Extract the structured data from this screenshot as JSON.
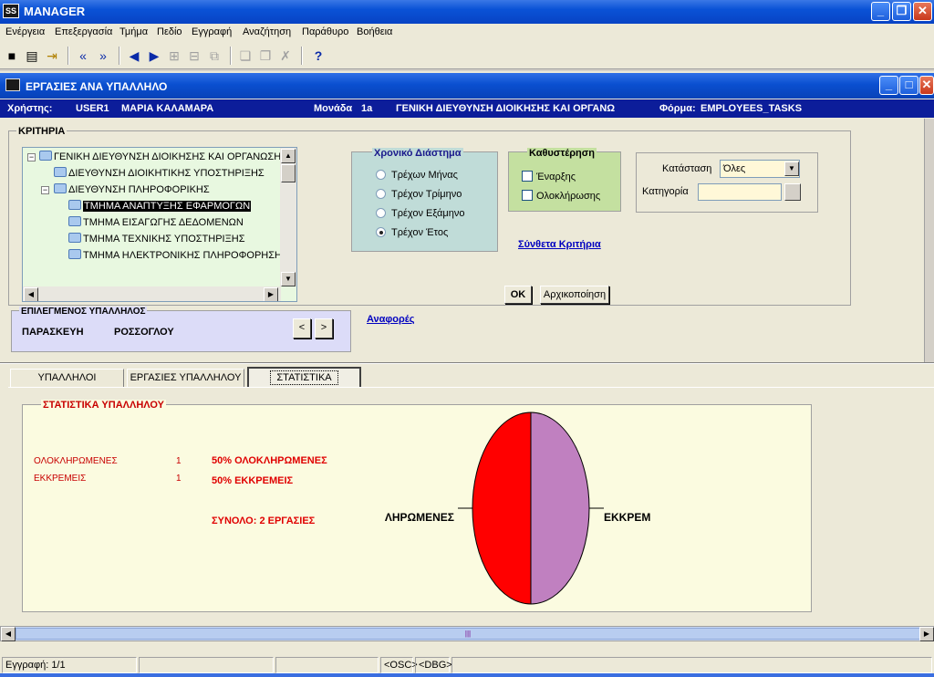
{
  "app": {
    "title": "MANAGER",
    "icon": "app-logo-icon"
  },
  "window_buttons": [
    "minimize-icon",
    "restore-icon",
    "close-icon"
  ],
  "menu": [
    "Ενέργεια",
    "Επεξεργασία",
    "Τμήμα",
    "Πεδίο",
    "Εγγραφή",
    "Αναζήτηση",
    "Παράθυρο",
    "Βοήθεια"
  ],
  "toolbar": {
    "icons": [
      "save-icon",
      "print-icon",
      "exit-icon",
      "first-record-icon",
      "last-record-icon",
      "previous-icon",
      "next-icon",
      "insert-record-icon",
      "delete-record-icon",
      "duplicate-icon",
      "copy-icon",
      "paste-icon",
      "clear-icon",
      "help-icon"
    ],
    "help_glyph": "?"
  },
  "form": {
    "title": "ΕΡΓΑΣΙΕΣ ΑΝΑ ΥΠΑΛΛΗΛΟ",
    "user_label": "Χρήστης:",
    "user_code": "USER1",
    "user_name": "ΜΑΡΙΑ ΚΑΛΑΜΑΡΑ",
    "unit_label": "Μονάδα",
    "unit_code": "1a",
    "unit_name": "ΓΕΝΙΚΗ ΔΙΕΥΘΥΝΣΗ ΔΙΟΙΚΗΣΗΣ ΚΑΙ ΟΡΓΑΝΩ",
    "form_label": "Φόρμα:",
    "form_code": "EMPLOYEES_TASKS"
  },
  "criteria": {
    "title": "ΚΡΙΤΗΡΙΑ",
    "tree": [
      {
        "label": "ΓΕΝΙΚΗ ΔΙΕΥΘΥΝΣΗ ΔΙΟΙΚΗΣΗΣ ΚΑΙ ΟΡΓΑΝΩΣΗΣ",
        "selected": false
      },
      {
        "label": "ΔΙΕΥΘΥΝΣΗ ΔΙΟΙΚΗΤΙΚΗΣ ΥΠΟΣΤΗΡΙΞΗΣ",
        "selected": false
      },
      {
        "label": "ΔΙΕΥΘΥΝΣΗ ΠΛΗΡΟΦΟΡΙΚΗΣ",
        "selected": false
      },
      {
        "label": "ΤΜΗΜΑ ΑΝΑΠΤΥΞΗΣ ΕΦΑΡΜΟΓΩΝ",
        "selected": true
      },
      {
        "label": "ΤΜΗΜΑ ΕΙΣΑΓΩΓΗΣ ΔΕΔΟΜΕΝΩΝ",
        "selected": false
      },
      {
        "label": "ΤΜΗΜΑ ΤΕΧΝΙΚΗΣ ΥΠΟΣΤΗΡΙΞΗΣ",
        "selected": false
      },
      {
        "label": "ΤΜΗΜΑ ΗΛΕΚΤΡΟΝΙΚΗΣ ΠΛΗΡΟΦΟΡΗΣΗΣ",
        "selected": false
      }
    ],
    "period": {
      "title": "Χρονικό Διάστημα",
      "options": [
        "Τρέχων Μήνας",
        "Τρέχον Τρίμηνο",
        "Τρέχον Εξάμηνο",
        "Τρέχον Έτος"
      ],
      "selected": "Τρέχον Έτος"
    },
    "delay": {
      "title": "Καθυστέρηση",
      "options": [
        "Έναρξης",
        "Ολοκλήρωσης"
      ],
      "checked": []
    },
    "status_label": "Κατάσταση",
    "status_value": "Όλες",
    "category_label": "Κατηγορία",
    "category_value": "",
    "composite_link": "Σύνθετα Κριτήρια",
    "ok_button": "OK",
    "reset_button": "Αρχικοποίηση"
  },
  "selected_employee": {
    "title": "ΕΠΙΛΕΓΜΕΝΟΣ ΥΠΑΛΛΗΛΟΣ",
    "first_name": "ΠΑΡΑΣΚΕΥΗ",
    "last_name": "ΡΟΣΣΟΓΛΟΥ",
    "prev_label": "<",
    "next_label": ">"
  },
  "reports_link": "Αναφορές",
  "tabs": [
    "ΥΠΑΛΛΗΛΟΙ",
    "ΕΡΓΑΣΙΕΣ ΥΠΑΛΛΗΛΟΥ",
    "ΣΤΑΤΙΣΤΙΚΑ"
  ],
  "active_tab": "ΣΤΑΤΙΣΤΙΚΑ",
  "stats": {
    "title": "ΣΤΑΤΙΣΤΙΚΑ ΥΠΑΛΛΗΛΟΥ",
    "rows": [
      {
        "label": "ΟΛΟΚΛΗΡΩΜΕΝΕΣ",
        "count": "1",
        "percent_text": "50% ΟΛΟΚΛΗΡΩΜΕΝΕΣ"
      },
      {
        "label": "ΕΚΚΡΕΜΕΙΣ",
        "count": "1",
        "percent_text": "50% ΕΚΚΡΕΜΕΙΣ"
      }
    ],
    "total_text": "ΣΥΝΟΛΟ: 2 ΕΡΓΑΣΙΕΣ"
  },
  "chart_data": {
    "type": "pie",
    "slices": [
      {
        "label": "ΛΗΡΩΜΕΝΕΣ",
        "value": 1,
        "color": "#ff0000"
      },
      {
        "label": "ΕΚΚΡΕΜ",
        "value": 1,
        "color": "#c080c0"
      }
    ]
  },
  "statusbar": {
    "record": "Εγγραφή: 1/1",
    "osc": "<OSC>",
    "dbg": "<DBG>"
  }
}
